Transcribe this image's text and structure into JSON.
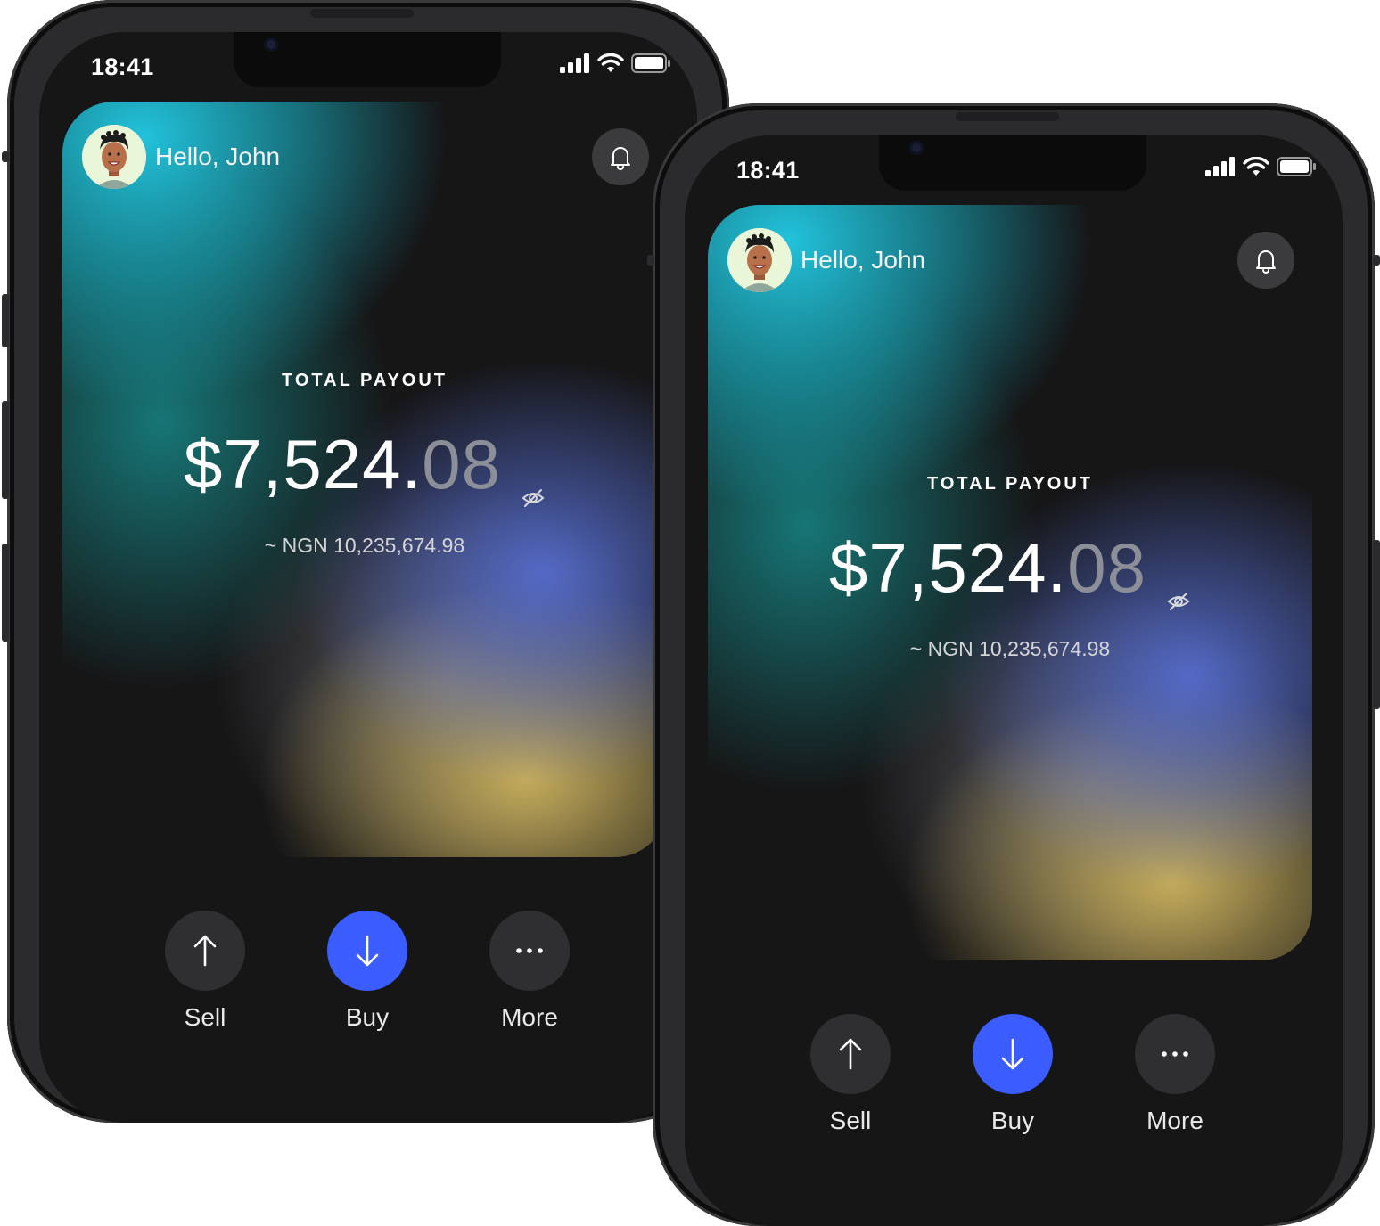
{
  "phones": [
    {
      "status_time": "18:41",
      "greeting": "Hello, John",
      "payout_label": "TOTAL PAYOUT",
      "amount_main": "$7,524.",
      "amount_cents": "08",
      "ngn_equivalent": "~ NGN 10,235,674.98",
      "actions": [
        {
          "label": "Sell",
          "icon": "arrow-up-icon"
        },
        {
          "label": "Buy",
          "icon": "arrow-down-icon"
        },
        {
          "label": "More",
          "icon": "more-dots-icon"
        }
      ]
    },
    {
      "status_time": "18:41",
      "greeting": "Hello, John",
      "payout_label": "TOTAL PAYOUT",
      "amount_main": "$7,524.",
      "amount_cents": "08",
      "ngn_equivalent": "~ NGN 10,235,674.98",
      "actions": [
        {
          "label": "Sell",
          "icon": "arrow-up-icon"
        },
        {
          "label": "Buy",
          "icon": "arrow-down-icon"
        },
        {
          "label": "More",
          "icon": "more-dots-icon"
        }
      ]
    }
  ],
  "colors": {
    "primary_button": "#3b5cff",
    "background": "#161617"
  }
}
